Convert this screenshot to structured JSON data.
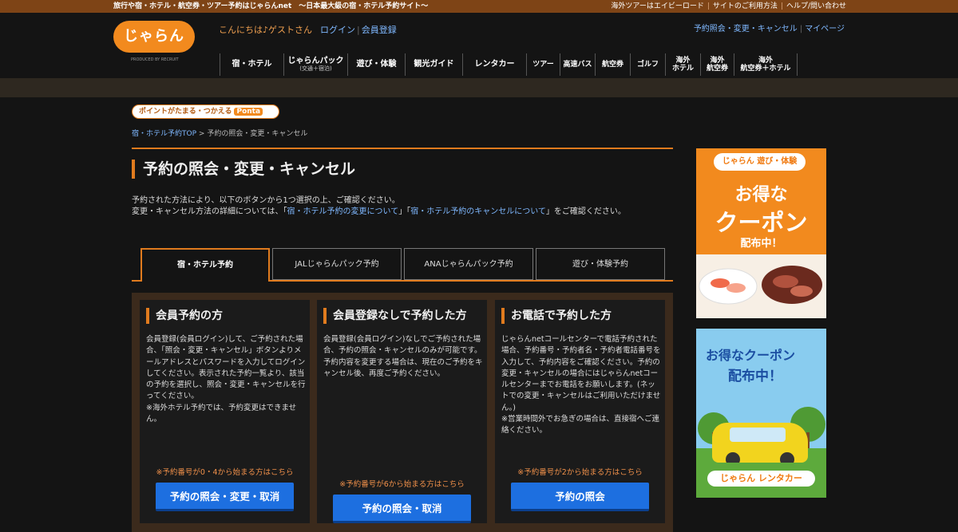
{
  "top_strip": {
    "tagline": "旅行や宿・ホテル・航空券・ツアー予約はじゃらんnet　〜日本最大級の宿・ホテル予約サイト〜",
    "links": [
      "海外ツアーはエイビーロード",
      "サイトのご利用方法",
      "ヘルプ/問い合わせ"
    ]
  },
  "header": {
    "logo_text": "じゃらん",
    "produced_by": "PRODUCED BY RECRUIT",
    "greeting": "こんにちは♪ゲストさん",
    "login": "ログイン",
    "register": "会員登録",
    "my_links": [
      "予約照会・変更・キャンセル",
      "マイページ"
    ]
  },
  "gnav": [
    {
      "label": "宿・ホテル"
    },
    {
      "label": "じゃらんパック",
      "sub": "(交通＋宿泊)"
    },
    {
      "label": "遊び・体験"
    },
    {
      "label": "観光ガイド"
    },
    {
      "label": "レンタカー"
    },
    {
      "label": "ツアー"
    },
    {
      "label": "高速バス"
    },
    {
      "label": "航空券"
    },
    {
      "label": "ゴルフ"
    },
    {
      "label": "海外",
      "label2": "ホテル"
    },
    {
      "label": "海外",
      "label2": "航空券"
    },
    {
      "label": "海外",
      "label2": "航空券＋ホテル"
    }
  ],
  "ponta": {
    "text": "ポイントがたまる・つかえる",
    "brand": "Ponta"
  },
  "breadcrumb": {
    "home": "宿・ホテル予約TOP",
    "sep": ">",
    "current": "予約の照会・変更・キャンセル"
  },
  "page_title": "予約の照会・変更・キャンセル",
  "intro": {
    "line1": "予約された方法により、以下のボタンから1つ選択の上、ご確認ください。",
    "line2_a": "変更・キャンセル方法の詳細については、「",
    "link1": "宿・ホテル予約の変更について",
    "mid": "」「",
    "link2": "宿・ホテル予約のキャンセルについて",
    "line2_b": "」をご確認ください。"
  },
  "tabs": [
    "宿・ホテル予約",
    "JALじゃらんパック予約",
    "ANAじゃらんパック予約",
    "遊び・体験予約"
  ],
  "cards": [
    {
      "title": "会員予約の方",
      "body": "会員登録(会員ログイン)して、ご予約された場合、「照会・変更・キャンセル」ボタンよりメールアドレスとパスワードを入力してログインしてください。表示された予約一覧より、該当の予約を選択し、照会・変更・キャンセルを行ってください。\n※海外ホテル予約では、予約変更はできません。",
      "note": "※予約番号が0・4から始まる方はこちら",
      "button": "予約の照会・変更・取消"
    },
    {
      "title": "会員登録なしで予約した方",
      "body": "会員登録(会員ログイン)なしでご予約された場合、予約の照会・キャンセルのみが可能です。予約内容を変更する場合は、現在のご予約をキャンセル後、再度ご予約ください。",
      "note": "※予約番号が6から始まる方はこちら",
      "button": "予約の照会・取消"
    },
    {
      "title": "お電話で予約した方",
      "body": "じゃらんnetコールセンターで電話予約された場合、予約番号・予約者名・予約者電話番号を入力して、予約内容をご確認ください。予約の変更・キャンセルの場合にはじゃらんnetコールセンターまでお電話をお願いします。(ネットでの変更・キャンセルはご利用いただけません。)\n※営業時間外でお急ぎの場合は、直接宿へご連絡ください。",
      "note": "※予約番号が2から始まる方はこちら",
      "button": "予約の照会"
    }
  ],
  "ads": {
    "ad1": {
      "brand": "じゃらん 遊び・体験",
      "line1": "お得な",
      "line2": "クーポン",
      "line3": "配布中！"
    },
    "ad2": {
      "line1": "お得なクーポン",
      "line2": "配布中！",
      "brand": "じゃらん レンタカー"
    }
  },
  "colors": {
    "accent": "#e07b1e",
    "link": "#7fb8ff",
    "button": "#1d6fe0",
    "top_strip": "#7e4416"
  }
}
